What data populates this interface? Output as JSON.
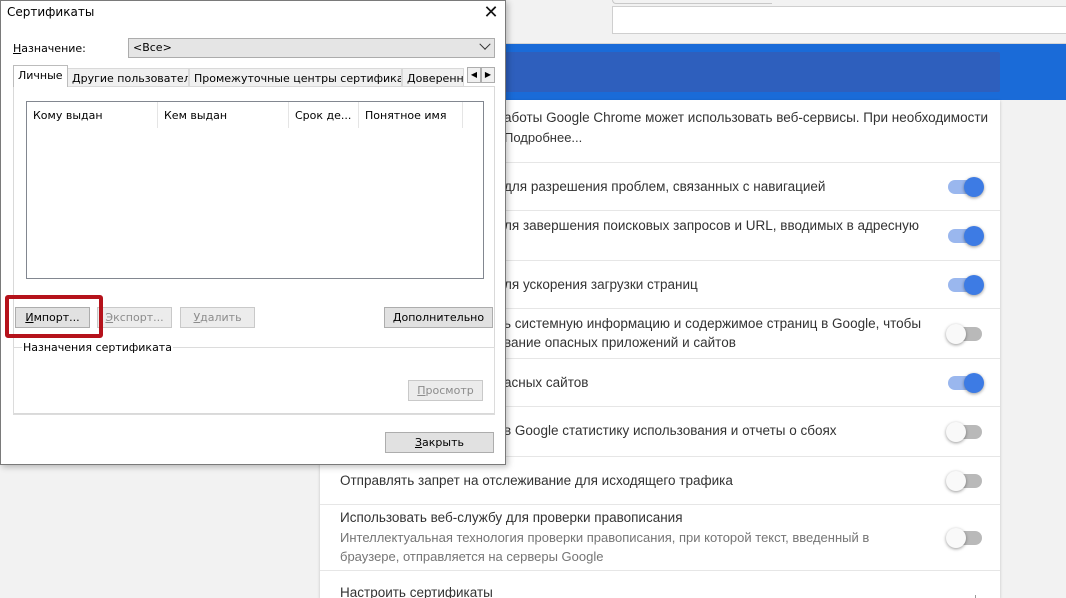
{
  "chrome": {
    "settings_rows": [
      {
        "text": "аботы Google Chrome может использовать веб-сервисы. При необходимости",
        "link": "Подробнее..."
      },
      {
        "text": "для разрешения проблем, связанных с навигацией",
        "toggle": "on"
      },
      {
        "text": "ля завершения поисковых запросов и URL, вводимых в адресную",
        "toggle": "on"
      },
      {
        "text": "ля ускорения загрузки страниц",
        "toggle": "on"
      },
      {
        "text": "ь системную информацию и содержимое страниц в Google, чтобы",
        "text2": "вание опасных приложений и сайтов",
        "toggle": "off"
      },
      {
        "text": "асных сайтов",
        "toggle": "on"
      },
      {
        "text": "в Google статистику использования и отчеты о сбоях",
        "toggle": "off"
      },
      {
        "text": "Отправлять запрет на отслеживание для исходящего трафика",
        "toggle": "off"
      },
      {
        "text": "Использовать веб-службу для проверки правописания",
        "sub": "Интеллектуальная технология проверки правописания, при которой текст, введенный в",
        "sub2": "браузере, отправляется на серверы Google",
        "toggle": "off"
      },
      {
        "text": "Настроить сертификаты"
      }
    ]
  },
  "dialog": {
    "title": "Сертификаты",
    "close": "✕",
    "purpose_label_u": "Н",
    "purpose_label_rest": "азначение:",
    "purpose_value": "<Все>",
    "tabs": [
      "Личные",
      "Другие пользователи",
      "Промежуточные центры сертификации",
      "Доверенн"
    ],
    "columns": [
      "Кому выдан",
      "Кем выдан",
      "Срок де...",
      "Понятное имя"
    ],
    "buttons": {
      "import_u": "И",
      "import_rest": "мпорт...",
      "export_u": "Э",
      "export_rest": "кспорт...",
      "delete_u": "У",
      "delete_rest": "далить",
      "advanced_u": "Д",
      "advanced_rest": "ополнительно",
      "view_u": "П",
      "view_rest": "росмотр",
      "close_u": "З",
      "close_rest": "акрыть"
    },
    "purposes_group": "Назначения сертификата"
  },
  "colors": {
    "highlight": "#b5121b",
    "chrome_blue": "#1a6bd8",
    "toggle_on": "#3d7be4"
  }
}
